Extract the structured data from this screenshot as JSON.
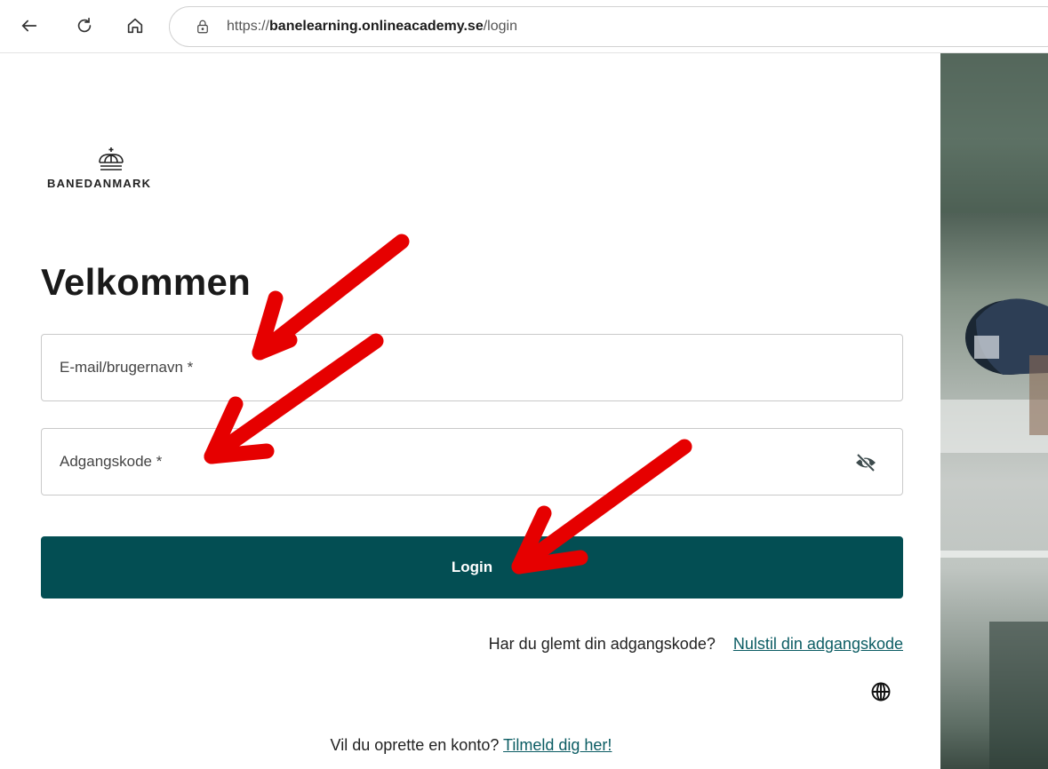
{
  "browser": {
    "url_prefix": "https://",
    "url_host": "banelearning.onlineacademy.se",
    "url_path": "/login"
  },
  "logo": {
    "text": "BANEDANMARK"
  },
  "page": {
    "title": "Velkommen"
  },
  "form": {
    "email_placeholder": "E-mail/brugernavn *",
    "password_placeholder": "Adgangskode *",
    "login_label": "Login"
  },
  "forgot": {
    "question": "Har du glemt din adgangskode?",
    "link": "Nulstil din adgangskode"
  },
  "signup": {
    "question": "Vil du oprette en konto?",
    "link": "Tilmeld dig her!"
  },
  "colors": {
    "primary": "#034e53",
    "link": "#0b5c63",
    "annotation_arrow": "#e60000"
  },
  "icons": [
    "back-arrow-icon",
    "refresh-icon",
    "home-icon",
    "lock-icon",
    "eye-off-icon",
    "globe-icon",
    "crown-icon"
  ]
}
